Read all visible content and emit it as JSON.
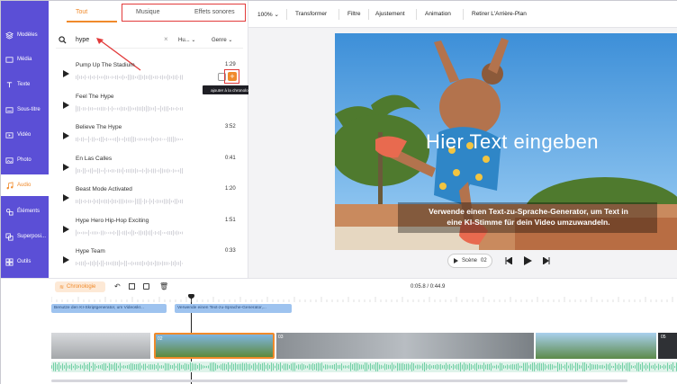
{
  "sidebar": {
    "items": [
      {
        "label": "Modèles",
        "icon": "layers-icon"
      },
      {
        "label": "Média",
        "icon": "folder-icon"
      },
      {
        "label": "Texte",
        "icon": "text-icon"
      },
      {
        "label": "Sous-titre",
        "icon": "subtitle-icon"
      },
      {
        "label": "Vidéo",
        "icon": "video-icon"
      },
      {
        "label": "Photo",
        "icon": "photo-icon"
      },
      {
        "label": "Audio",
        "icon": "music-icon",
        "active": true
      },
      {
        "label": "Éléments",
        "icon": "shapes-icon"
      },
      {
        "label": "Superposi...",
        "icon": "overlay-icon"
      },
      {
        "label": "Outils",
        "icon": "tools-icon"
      }
    ]
  },
  "panel": {
    "tabs": [
      {
        "label": "Tout",
        "active": true
      },
      {
        "label": "Musique"
      },
      {
        "label": "Effets sonores"
      }
    ],
    "search": {
      "value": "hype",
      "filter1": "Hu...",
      "filter2": "Genre"
    },
    "tracks": [
      {
        "title": "Pump Up The Stadium",
        "duration": "1:29"
      },
      {
        "title": "Feel The Hype",
        "duration": ""
      },
      {
        "title": "Believe The Hype",
        "duration": "3:52"
      },
      {
        "title": "En Las Calles",
        "duration": "0:41"
      },
      {
        "title": "Beast Mode Activated",
        "duration": "1:20"
      },
      {
        "title": "Hype Hero Hip-Hop Exciting",
        "duration": "1:51"
      },
      {
        "title": "Hype Team",
        "duration": "0:33"
      }
    ],
    "tooltip": "ajouter à la chronologie"
  },
  "toolbar": {
    "zoom": "100%",
    "items": [
      "Transformer",
      "Filtre",
      "Ajustement",
      "Animation",
      "Retirer L'Arrière-Plan"
    ]
  },
  "video": {
    "title": "Hier Text eingeben",
    "subtitle_line1": "Verwende einen Text-zu-Sprache-Generator, um Text in",
    "subtitle_line2": "eine KI-Stimme für dein Video umzuwandeln.",
    "scene_label": "Scène",
    "scene_number": "02"
  },
  "timeline": {
    "chronologie_label": "Chronologie",
    "time_current": "0:05.8",
    "time_total": "0:44.9",
    "text_clip_1": "Benutze den KI-Skriptgenerator, um Videoskr...",
    "text_clip_2": "Verwende einen Text-zu-Sprache-Generator,...",
    "clip_labels": [
      "02",
      "03",
      "05"
    ]
  },
  "colors": {
    "accent": "#f08a2b",
    "sidebar": "#5b4fd6",
    "highlight": "#e23b3b"
  }
}
